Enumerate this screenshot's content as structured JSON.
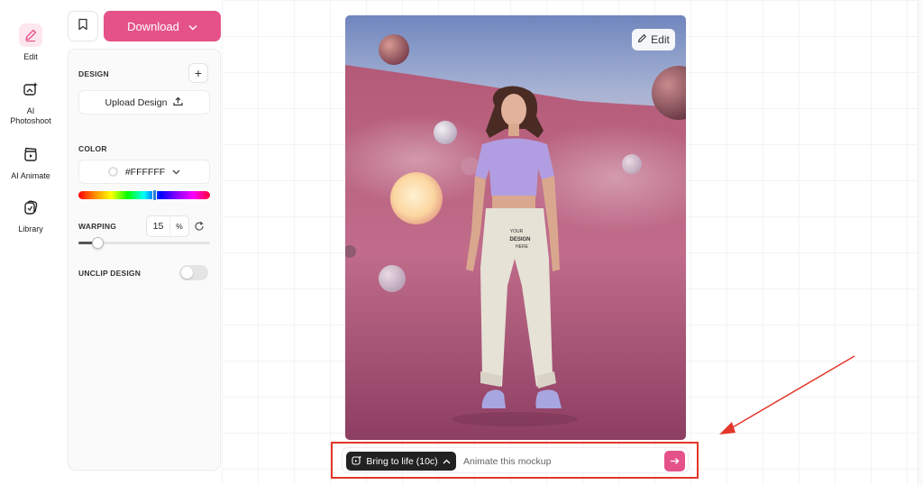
{
  "sidebar": {
    "items": [
      {
        "label": "Edit",
        "icon": "pencil-icon",
        "active": true
      },
      {
        "label": "AI\nPhotoshoot",
        "icon": "ai-photo-icon",
        "active": false
      },
      {
        "label": "AI Animate",
        "icon": "clapper-icon",
        "active": false
      },
      {
        "label": "Library",
        "icon": "library-icon",
        "active": false
      }
    ]
  },
  "toolbar": {
    "download_label": "Download",
    "bookmark_icon": "bookmark-icon"
  },
  "panel": {
    "design_label": "DESIGN",
    "upload_label": "Upload Design",
    "color_label": "COLOR",
    "color_value": "#FFFFFF",
    "warping_label": "WARPING",
    "warping_value": "15",
    "warping_unit": "%",
    "warping_slider_level": 0.15,
    "unclip_label": "UNCLIP DESIGN",
    "unclip_enabled": false
  },
  "mockup": {
    "edit_label": "Edit",
    "shirt_print_lines": [
      "YOUR",
      "DESIGN",
      "HERE"
    ]
  },
  "prompt": {
    "bring_label": "Bring to life (10c)",
    "placeholder": "Animate this mockup"
  },
  "colors": {
    "accent": "#e55289",
    "dark_button": "#222222",
    "highlight": "#e2372a"
  }
}
